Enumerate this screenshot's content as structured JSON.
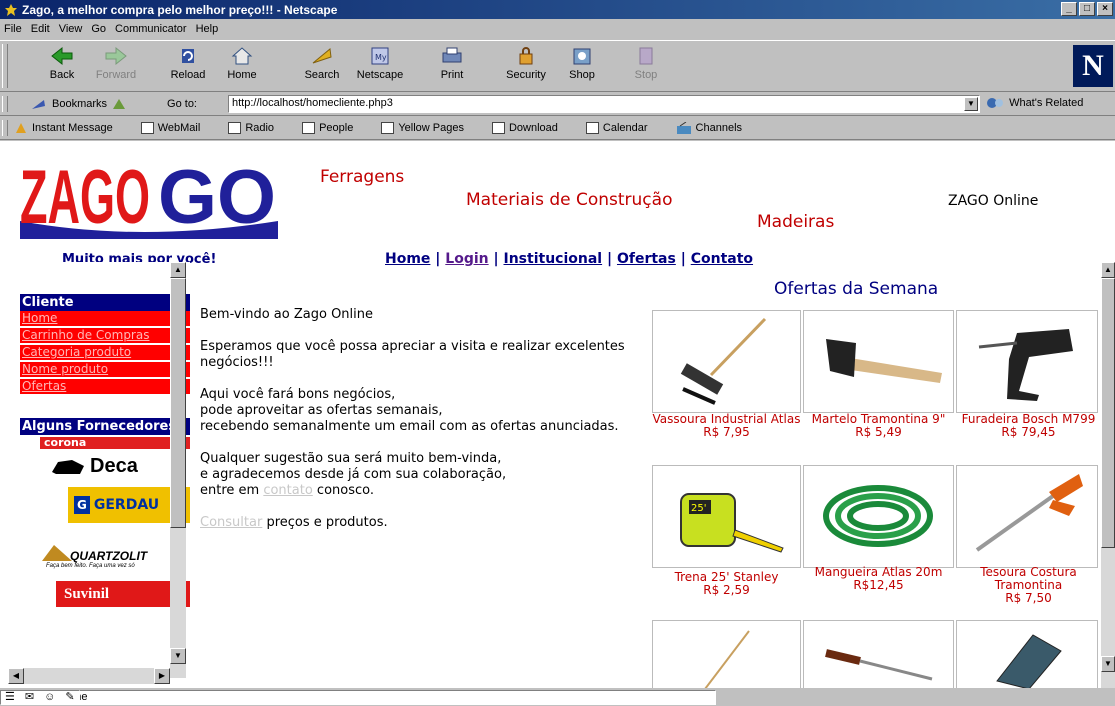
{
  "window": {
    "title": "Zago, a melhor compra pelo melhor preço!!! - Netscape"
  },
  "menu": [
    "File",
    "Edit",
    "View",
    "Go",
    "Communicator",
    "Help"
  ],
  "toolbar": [
    {
      "label": "Back",
      "icon": "back-arrow-icon",
      "enabled": true
    },
    {
      "label": "Forward",
      "icon": "forward-arrow-icon",
      "enabled": false
    },
    {
      "label": "Reload",
      "icon": "reload-icon",
      "enabled": true
    },
    {
      "label": "Home",
      "icon": "home-icon",
      "enabled": true
    },
    {
      "label": "Search",
      "icon": "search-icon",
      "enabled": true
    },
    {
      "label": "Netscape",
      "icon": "netscape-icon",
      "enabled": true
    },
    {
      "label": "Print",
      "icon": "print-icon",
      "enabled": true
    },
    {
      "label": "Security",
      "icon": "lock-icon",
      "enabled": true
    },
    {
      "label": "Shop",
      "icon": "shop-icon",
      "enabled": true
    },
    {
      "label": "Stop",
      "icon": "stop-icon",
      "enabled": false
    }
  ],
  "location": {
    "bookmarks_label": "Bookmarks",
    "goto_label": "Go to:",
    "url": "http://localhost/homecliente.php3",
    "related_label": "What's Related"
  },
  "personal_bar": [
    "Instant Message",
    "WebMail",
    "Radio",
    "People",
    "Yellow Pages",
    "Download",
    "Calendar",
    "Channels"
  ],
  "page": {
    "logo_text": "ZAGO",
    "tagline_1": "Ferragens",
    "tagline_2": "Materiais de Construção",
    "tagline_3": "Madeiras",
    "site_name": "ZAGO Online",
    "slogan": "Muito mais por você!",
    "nav": [
      "Home",
      "Login",
      "Institucional",
      "Ofertas",
      "Contato"
    ],
    "sidebar": {
      "client_header": "Cliente",
      "client_items": [
        "Home",
        "Carrinho de Compras",
        "Categoria produto",
        "Nome produto",
        "Ofertas"
      ],
      "suppliers_header": "Alguns Fornecedores",
      "suppliers": [
        "corona",
        "Deca",
        "GERDAU",
        "QUARTZOLIT",
        "Suvinil"
      ],
      "quartzolit_slogan": "Faça bem feito. Faça uma vez só"
    },
    "welcome": {
      "p1": "Bem-vindo ao Zago Online",
      "p2": "Esperamos que você possa apreciar a visita e realizar excelentes negócios!!!",
      "p3_l1": "Aqui você fará bons negócios,",
      "p3_l2": "pode aproveitar as ofertas semanais,",
      "p3_l3": "recebendo semanalmente um email com as ofertas anunciadas.",
      "p4_l1": "Qualquer sugestão sua será muito bem-vinda,",
      "p4_l2": "e agradecemos desde já com sua colaboração,",
      "p4_l3a": "entre em ",
      "p4_link": "contato",
      "p4_l3b": " conosco.",
      "p5_link": "Consultar",
      "p5_rest": " preços e produtos."
    },
    "offers_title": "Ofertas da Semana",
    "products": [
      {
        "name": "Vassoura Industrial Atlas",
        "price": "R$ 7,95",
        "icon": "broom-icon"
      },
      {
        "name": "Martelo Tramontina 9\"",
        "price": "R$ 5,49",
        "icon": "hammer-icon"
      },
      {
        "name": "Furadeira Bosch M799",
        "price": "R$ 79,45",
        "icon": "drill-icon"
      },
      {
        "name": "Trena 25' Stanley",
        "price": "R$ 2,59",
        "icon": "tape-measure-icon"
      },
      {
        "name": "Mangueira Atlas 20m",
        "price": "R$12,45",
        "icon": "hose-icon"
      },
      {
        "name": "Tesoura Costura Tramontina",
        "price": "R$ 7,50",
        "icon": "scissors-icon"
      }
    ],
    "products_row3_icons": [
      "rake-icon",
      "screwdriver-icon",
      "drill-bit-set-icon"
    ]
  },
  "status": {
    "text": "Document: Done"
  },
  "colors": {
    "title_bar": "#0a246a",
    "brand_red": "#c00000",
    "nav_blue": "#000080",
    "menu_red": "#ff0000"
  }
}
